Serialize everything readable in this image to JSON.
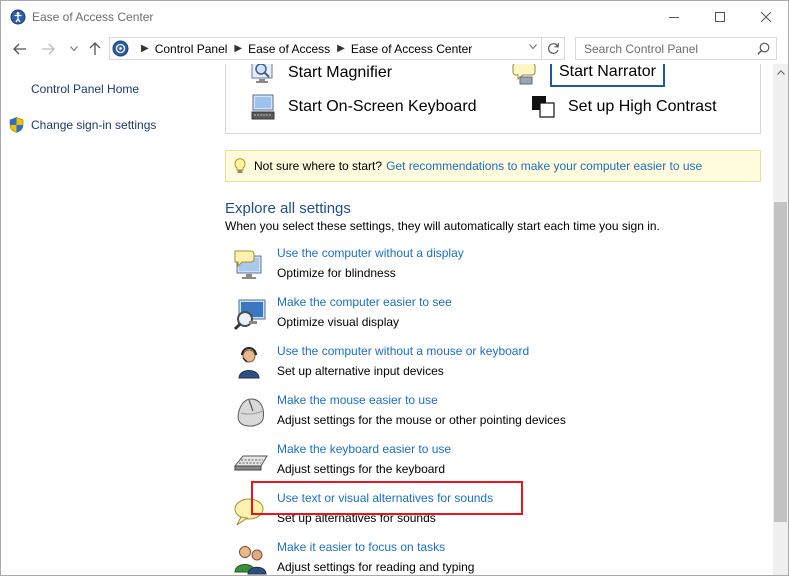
{
  "window": {
    "title": "Ease of Access Center"
  },
  "navbar": {
    "breadcrumbs": [
      "Control Panel",
      "Ease of Access",
      "Ease of Access Center"
    ],
    "search_placeholder": "Search Control Panel"
  },
  "leftnav": {
    "home": "Control Panel Home",
    "signin": "Change sign-in settings"
  },
  "quick_access": {
    "magnifier": "Start Magnifier",
    "narrator": "Start Narrator",
    "keyboard": "Start On-Screen Keyboard",
    "contrast": "Set up High Contrast"
  },
  "hint": {
    "text": "Not sure where to start?",
    "link": "Get recommendations to make your computer easier to use"
  },
  "explore": {
    "title": "Explore all settings",
    "description": "When you select these settings, they will automatically start each time you sign in.",
    "items": [
      {
        "link": "Use the computer without a display",
        "desc": "Optimize for blindness",
        "icon": "display-speech-icon"
      },
      {
        "link": "Make the computer easier to see",
        "desc": "Optimize visual display",
        "icon": "magnify-monitor-icon"
      },
      {
        "link": "Use the computer without a mouse or keyboard",
        "desc": "Set up alternative input devices",
        "icon": "person-headset-icon"
      },
      {
        "link": "Make the mouse easier to use",
        "desc": "Adjust settings for the mouse or other pointing devices",
        "icon": "mouse-icon"
      },
      {
        "link": "Make the keyboard easier to use",
        "desc": "Adjust settings for the keyboard",
        "icon": "keyboard-icon"
      },
      {
        "link": "Use text or visual alternatives for sounds",
        "desc": "Set up alternatives for sounds",
        "icon": "speech-bubble-icon"
      },
      {
        "link": "Make it easier to focus on tasks",
        "desc": "Adjust settings for reading and typing",
        "icon": "people-icon"
      }
    ]
  },
  "colors": {
    "link": "#1a6fc4",
    "section_title": "#1e4e8c",
    "hint_bg": "#fffbdc",
    "highlight": "#e8161b",
    "focus_border": "#1c5c9a"
  }
}
